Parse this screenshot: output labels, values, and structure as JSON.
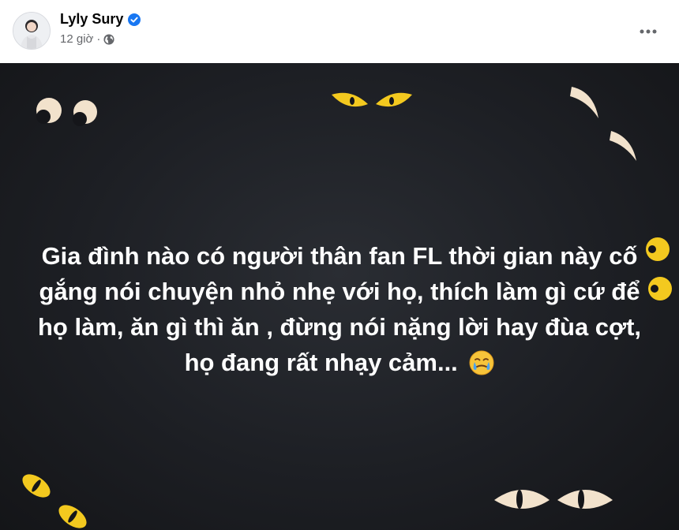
{
  "post": {
    "author": {
      "name": "Lyly Sury",
      "verified": true,
      "avatar_icon": "user-avatar-photo"
    },
    "timestamp": "12 giờ",
    "separator": "·",
    "audience_icon": "globe-icon",
    "more_icon": "more-horizontal-icon",
    "text": "Gia đình nào có người thân fan FL thời gian này cố gắng nói chuyện nhỏ nhẹ với họ, thích làm gì cứ để họ làm, ăn gì thì ăn , đừng nói nặng lời hay đùa cợt, họ đang rất nhạy cảm...",
    "emoji_icon": "crying-smiling-face-emoji",
    "background": {
      "colors": {
        "dark_bg": "#1d1f24",
        "eye_cream": "#f2e2cc",
        "eye_yellow": "#f3c91f",
        "pupil": "#15161a"
      }
    }
  },
  "colors": {
    "verified_blue": "#1877f2",
    "meta_gray": "#65676b",
    "name_black": "#050505"
  }
}
